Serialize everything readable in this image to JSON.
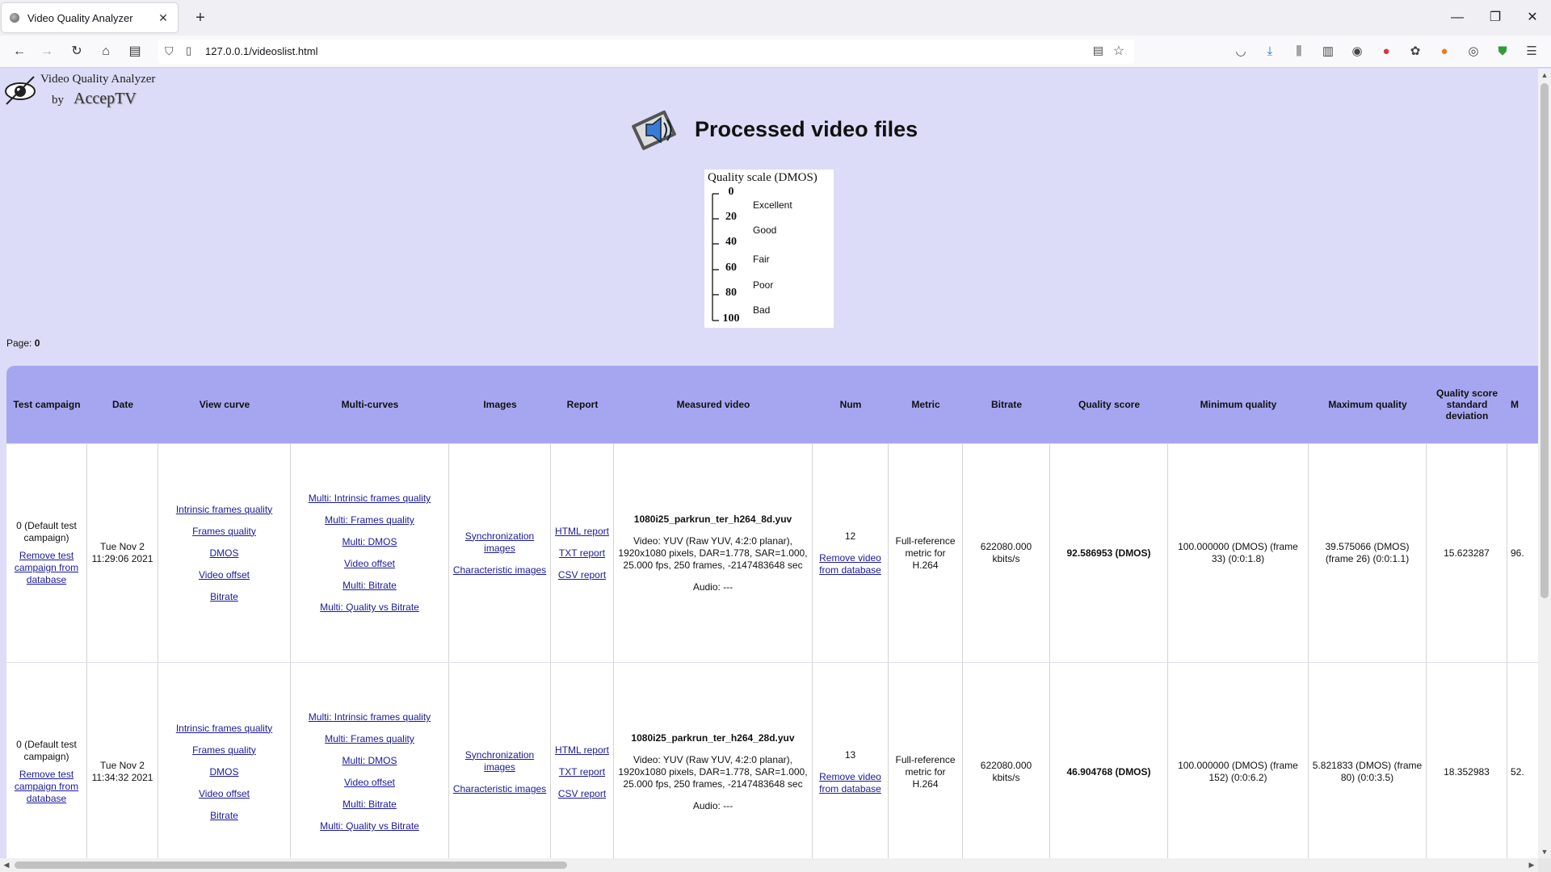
{
  "browser": {
    "tab_title": "Video Quality Analyzer",
    "tab_close": "✕",
    "new_tab": "+",
    "url": "127.0.0.1/videoslist.html",
    "window_controls": {
      "minimize": "—",
      "restore": "❐",
      "close": "✕"
    }
  },
  "logo": {
    "line1": "Video Quality Analyzer",
    "by": "by",
    "brand": "AccepTV"
  },
  "page_title": "Processed video files",
  "quality_scale": {
    "title": "Quality scale (DMOS)",
    "ticks": [
      "0",
      "20",
      "40",
      "60",
      "80",
      "100"
    ],
    "labels": [
      "Excellent",
      "Good",
      "Fair",
      "Poor",
      "Bad"
    ]
  },
  "page_label": "Page:",
  "page_number": "0",
  "columns": {
    "test_campaign": "Test campaign",
    "date": "Date",
    "view_curve": "View curve",
    "multi_curves": "Multi-curves",
    "images": "Images",
    "report": "Report",
    "measured_video": "Measured video",
    "num": "Num",
    "metric": "Metric",
    "bitrate": "Bitrate",
    "quality_score": "Quality score",
    "min_quality": "Minimum quality",
    "max_quality": "Maximum quality",
    "std_dev": "Quality score standard deviation",
    "next": "M"
  },
  "rows": [
    {
      "campaign": "0 (Default test campaign)",
      "remove_campaign": "Remove test campaign from database",
      "date": "Tue Nov 2 11:29:06 2021",
      "view_curve": [
        "Intrinsic frames quality",
        "Frames quality",
        "DMOS",
        "Video offset",
        "Bitrate"
      ],
      "multi_curves": [
        "Multi: Intrinsic frames quality",
        "Multi: Frames quality",
        "Multi: DMOS",
        "Video offset",
        "Multi: Bitrate",
        "Multi: Quality vs Bitrate"
      ],
      "images": [
        "Synchronization images",
        "Characteristic images"
      ],
      "report": [
        "HTML report",
        "TXT report",
        "CSV report"
      ],
      "video_name": "1080i25_parkrun_ter_h264_8d.yuv",
      "video_desc": "Video: YUV (Raw YUV, 4:2:0 planar), 1920x1080 pixels, DAR=1.778, SAR=1.000, 25.000 fps, 250 frames, -2147483648 sec",
      "audio": "Audio: ---",
      "num": "12",
      "remove_video": "Remove video from database",
      "metric": "Full-reference metric for H.264",
      "bitrate": "622080.000 kbits/s",
      "quality_score": "92.586953 (DMOS)",
      "min_quality": "100.000000 (DMOS) (frame 33) (0:0:1.8)",
      "max_quality": "39.575066 (DMOS) (frame 26) (0:0:1.1)",
      "std_dev": "15.623287",
      "next": "96."
    },
    {
      "campaign": "0 (Default test campaign)",
      "remove_campaign": "Remove test campaign from database",
      "date": "Tue Nov 2 11:34:32 2021",
      "view_curve": [
        "Intrinsic frames quality",
        "Frames quality",
        "DMOS",
        "Video offset",
        "Bitrate"
      ],
      "multi_curves": [
        "Multi: Intrinsic frames quality",
        "Multi: Frames quality",
        "Multi: DMOS",
        "Video offset",
        "Multi: Bitrate",
        "Multi: Quality vs Bitrate"
      ],
      "images": [
        "Synchronization images",
        "Characteristic images"
      ],
      "report": [
        "HTML report",
        "TXT report",
        "CSV report"
      ],
      "video_name": "1080i25_parkrun_ter_h264_28d.yuv",
      "video_desc": "Video: YUV (Raw YUV, 4:2:0 planar), 1920x1080 pixels, DAR=1.778, SAR=1.000, 25.000 fps, 250 frames, -2147483648 sec",
      "audio": "Audio: ---",
      "num": "13",
      "remove_video": "Remove video from database",
      "metric": "Full-reference metric for H.264",
      "bitrate": "622080.000 kbits/s",
      "quality_score": "46.904768 (DMOS)",
      "min_quality": "100.000000 (DMOS) (frame 152) (0:0:6.2)",
      "max_quality": "5.821833 (DMOS) (frame 80) (0:0:3.5)",
      "std_dev": "18.352983",
      "next": "52."
    }
  ],
  "icons": {
    "back": "back-arrow-icon",
    "forward": "forward-arrow-icon",
    "reload": "reload-icon",
    "home": "home-icon",
    "speaker": "speaker-icon"
  },
  "colors": {
    "page_bg": "#dcdcf8",
    "header_bg": "#a6a6f0",
    "link": "#1a1a99"
  }
}
